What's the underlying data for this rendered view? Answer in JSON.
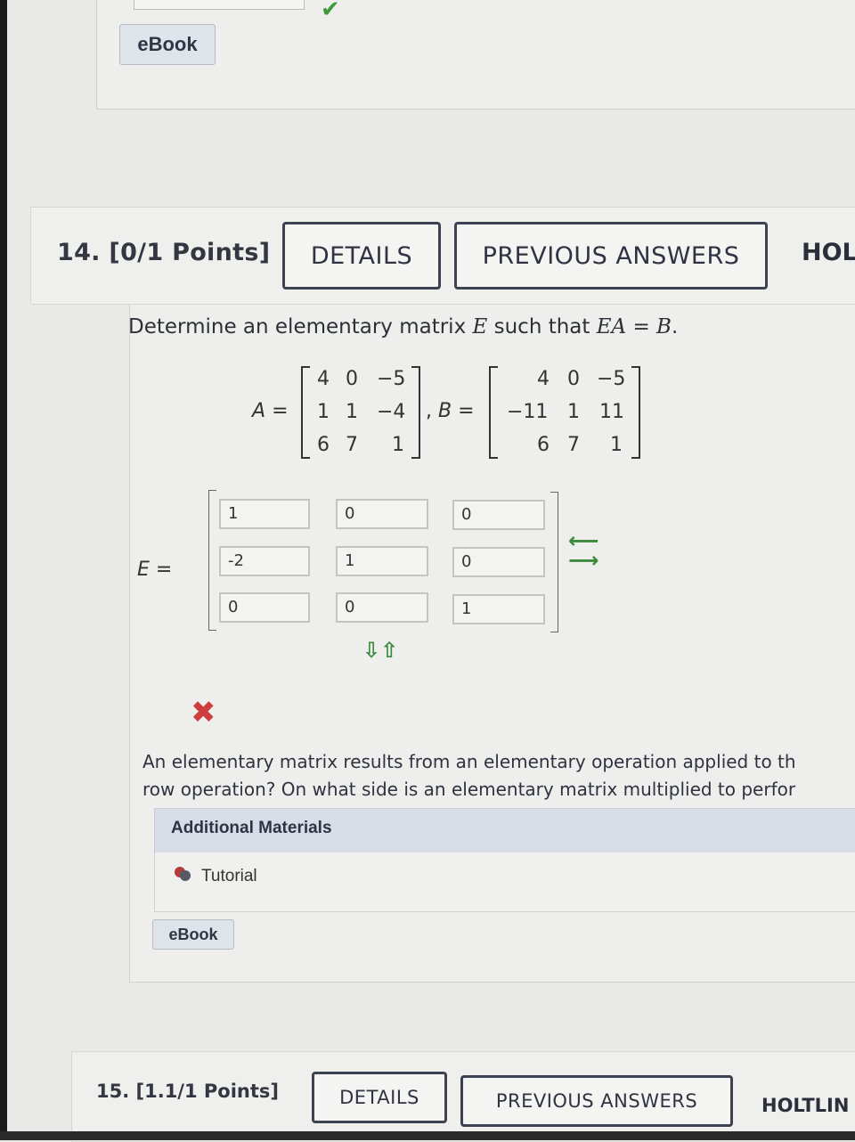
{
  "prev_question": {
    "ebook_label": "eBook"
  },
  "question": {
    "title": "14. [0/1 Points]",
    "details_label": "DETAILS",
    "previous_answers_label": "PREVIOUS ANSWERS",
    "holt_label": "HOL",
    "prompt_pre": "Determine an elementary matrix ",
    "prompt_E": "E",
    "prompt_mid": " such that ",
    "prompt_EA": "EA",
    "prompt_eq": " = ",
    "prompt_B": "B",
    "prompt_end": ".",
    "matrix_A_label": "A",
    "matrix_B_label": "B",
    "matrix_A": [
      [
        "4",
        "0",
        "−5"
      ],
      [
        "1",
        "1",
        "−4"
      ],
      [
        "6",
        "7",
        "1"
      ]
    ],
    "matrix_B": [
      [
        "4",
        "0",
        "−5"
      ],
      [
        "−11",
        "1",
        "11"
      ],
      [
        "6",
        "7",
        "1"
      ]
    ],
    "matrix_E_label": "E",
    "equals": "=",
    "comma": ",",
    "matrix_E_inputs": [
      [
        "1",
        "0",
        "0"
      ],
      [
        "-2",
        "1",
        "0"
      ],
      [
        "0",
        "0",
        "1"
      ]
    ],
    "status": "incorrect",
    "hint_line1": "An elementary matrix results from an elementary operation applied to th",
    "hint_line2": "row operation? On what side is an elementary matrix multiplied to perfor",
    "additional_materials_label": "Additional Materials",
    "tutorial_label": "Tutorial",
    "ebook_label": "eBook"
  },
  "next_question": {
    "title": "15. [1.1/1 Points]",
    "details_label": "DETAILS",
    "previous_answers_label": "PREVIOUS ANSWERS",
    "holt_label": "HOLTLIN"
  },
  "colors": {
    "correct": "#3e9a3e",
    "incorrect": "#cf3d3d",
    "accent_bar": "#d9dde7"
  }
}
